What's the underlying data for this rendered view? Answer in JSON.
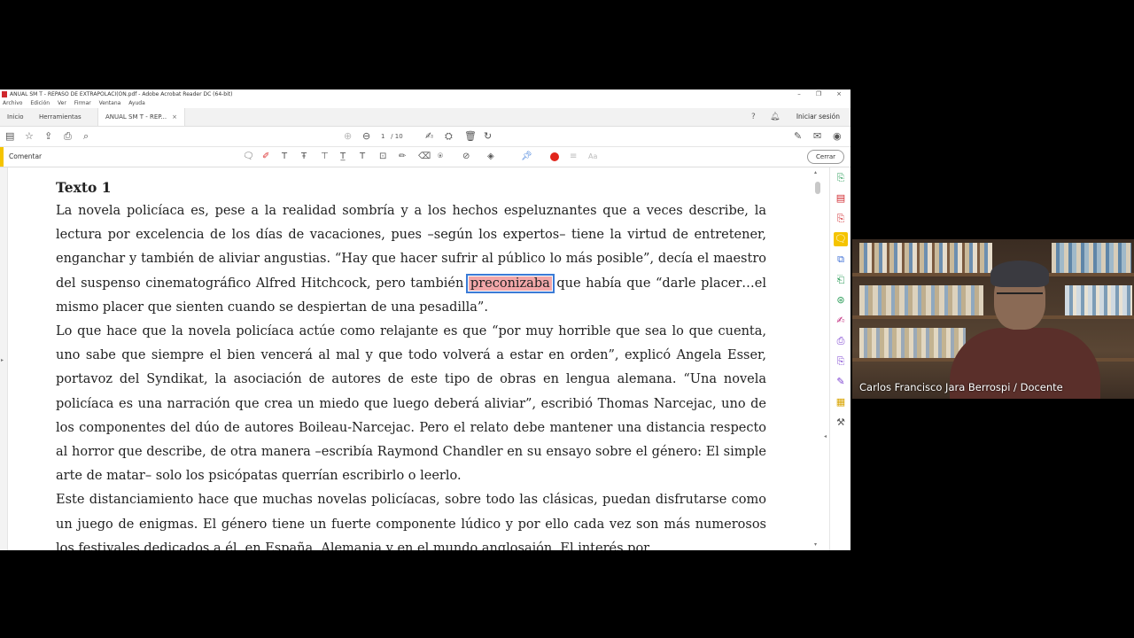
{
  "window": {
    "title": "ANUAL SM T - REPASO DE EXTRAPOLACI(ON.pdf - Adobe Acrobat Reader DC (64-bit)",
    "controls": [
      "–",
      "❐",
      "×"
    ]
  },
  "menu": [
    "Archivo",
    "Edición",
    "Ver",
    "Firmar",
    "Ventana",
    "Ayuda"
  ],
  "tabs": {
    "home": "Inicio",
    "tools": "Herramientas",
    "document": "ANUAL SM T - REP...",
    "signin": "Iniciar sesión"
  },
  "toolbar": {
    "page_current": "1",
    "page_total": "/ 10"
  },
  "comment_bar": {
    "label": "Comentar",
    "close": "Cerrar"
  },
  "document": {
    "heading": "Texto 1",
    "p1_before": "La novela policíaca es, pese a la realidad sombría y a los hechos espeluznantes que a veces describe, la lectura por excelencia de los días de vacaciones, pues –según los expertos– tiene la virtud de entretener, enganchar y también de aliviar angustias. “Hay que hacer sufrir al público lo más posible”, decía el maestro del suspenso cinematográfico Alfred Hitchcock, pero también ",
    "p1_highlight": "preconizaba",
    "p1_after": " que había que “darle placer…el mismo placer que sienten cuando se despiertan de una pesadilla”.",
    "p2": "Lo que hace que la novela policíaca actúe como relajante es que “por muy horrible que sea lo que cuenta, uno sabe que siempre el bien vencerá al mal y que todo volverá a estar en orden”, explicó Angela Esser, portavoz del Syndikat, la asociación de autores de este tipo de obras en lengua alemana. “Una novela policíaca es una narración que crea un miedo que luego deberá aliviar”, escribió Thomas Narcejac, uno de los componentes del dúo de autores Boileau-Narcejac. Pero el relato debe mantener una distancia respecto al horror que describe, de otra manera –escribía Raymond Chandler en su ensayo sobre el género: El simple arte de matar– solo los psicópatas querrían escribirlo o leerlo.",
    "p3": "Este distanciamiento hace que muchas novelas policíacas, sobre todo las clásicas, puedan disfrutarse como un juego de enigmas. El género tiene un fuerte componente lúdico y por ello cada vez son más numerosos los festivales dedicados a él, en España, Alemania y en el mundo anglosajón. El interés por"
  },
  "webcam": {
    "caption": "Carlos Francisco Jara Berrospi / Docente"
  },
  "colors": {
    "accent": "#f5c400",
    "highlight": "#f2a7a9",
    "record": "#e1251b"
  }
}
